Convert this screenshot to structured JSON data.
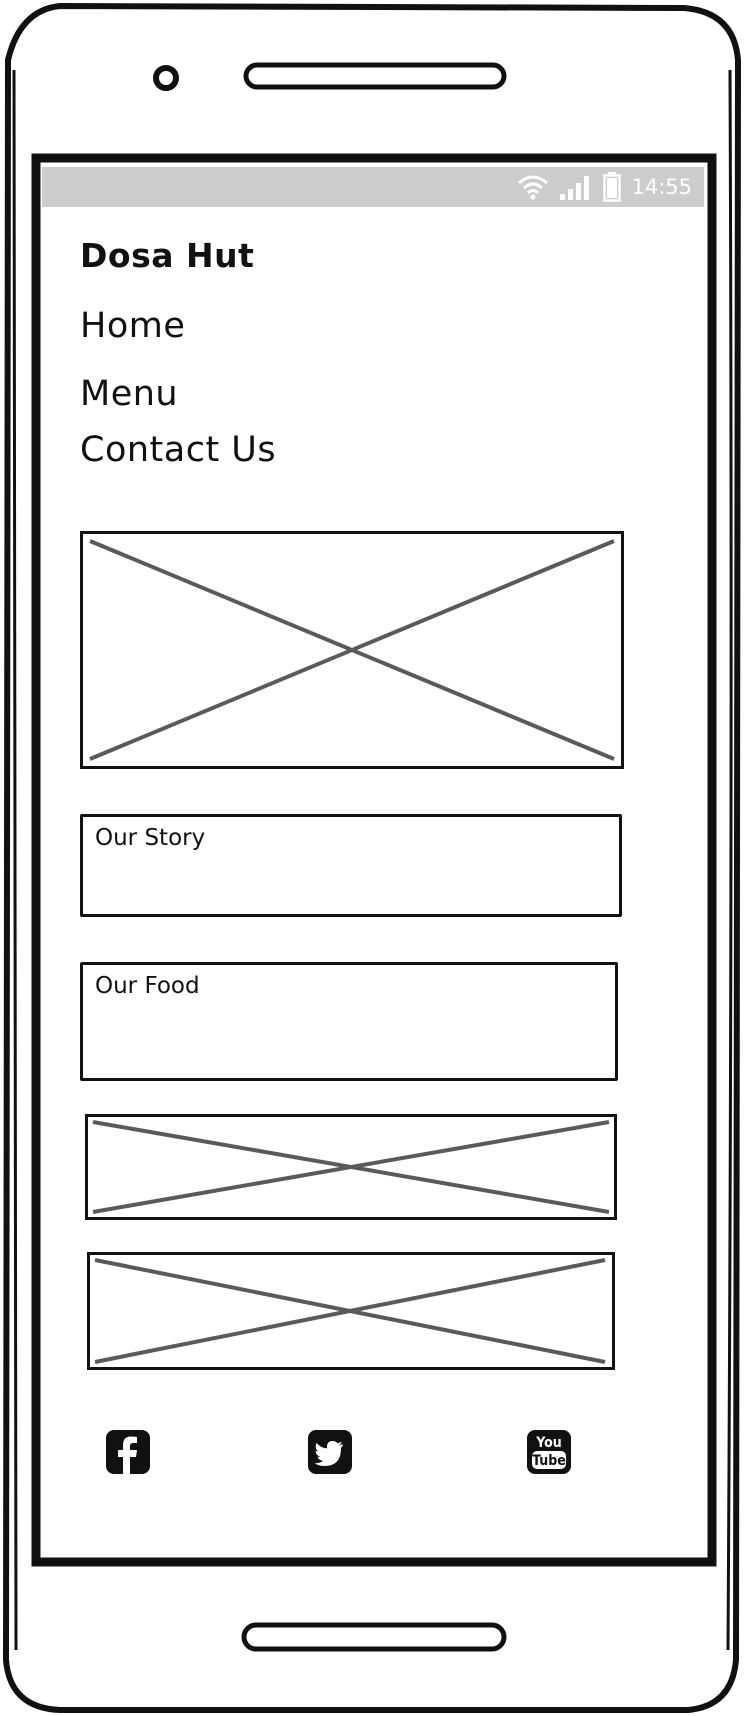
{
  "status_bar": {
    "time": "14:55",
    "icons": [
      "wifi-icon",
      "signal-icon",
      "battery-icon"
    ]
  },
  "nav": {
    "brand": "Dosa Hut",
    "items": [
      {
        "label": "Home"
      },
      {
        "label": "Menu"
      },
      {
        "label": "Contact Us"
      }
    ]
  },
  "sections": [
    {
      "label": "Our Story"
    },
    {
      "label": "Our Food"
    }
  ],
  "footer": {
    "icons": [
      "facebook-icon",
      "twitter-icon",
      "youtube-icon"
    ],
    "youtube_text_top": "You",
    "youtube_text_bottom": "Tube"
  },
  "colors": {
    "outline": "#111111",
    "placeholder_cross": "#5a5a5a",
    "status_bar": "#cccccc"
  }
}
